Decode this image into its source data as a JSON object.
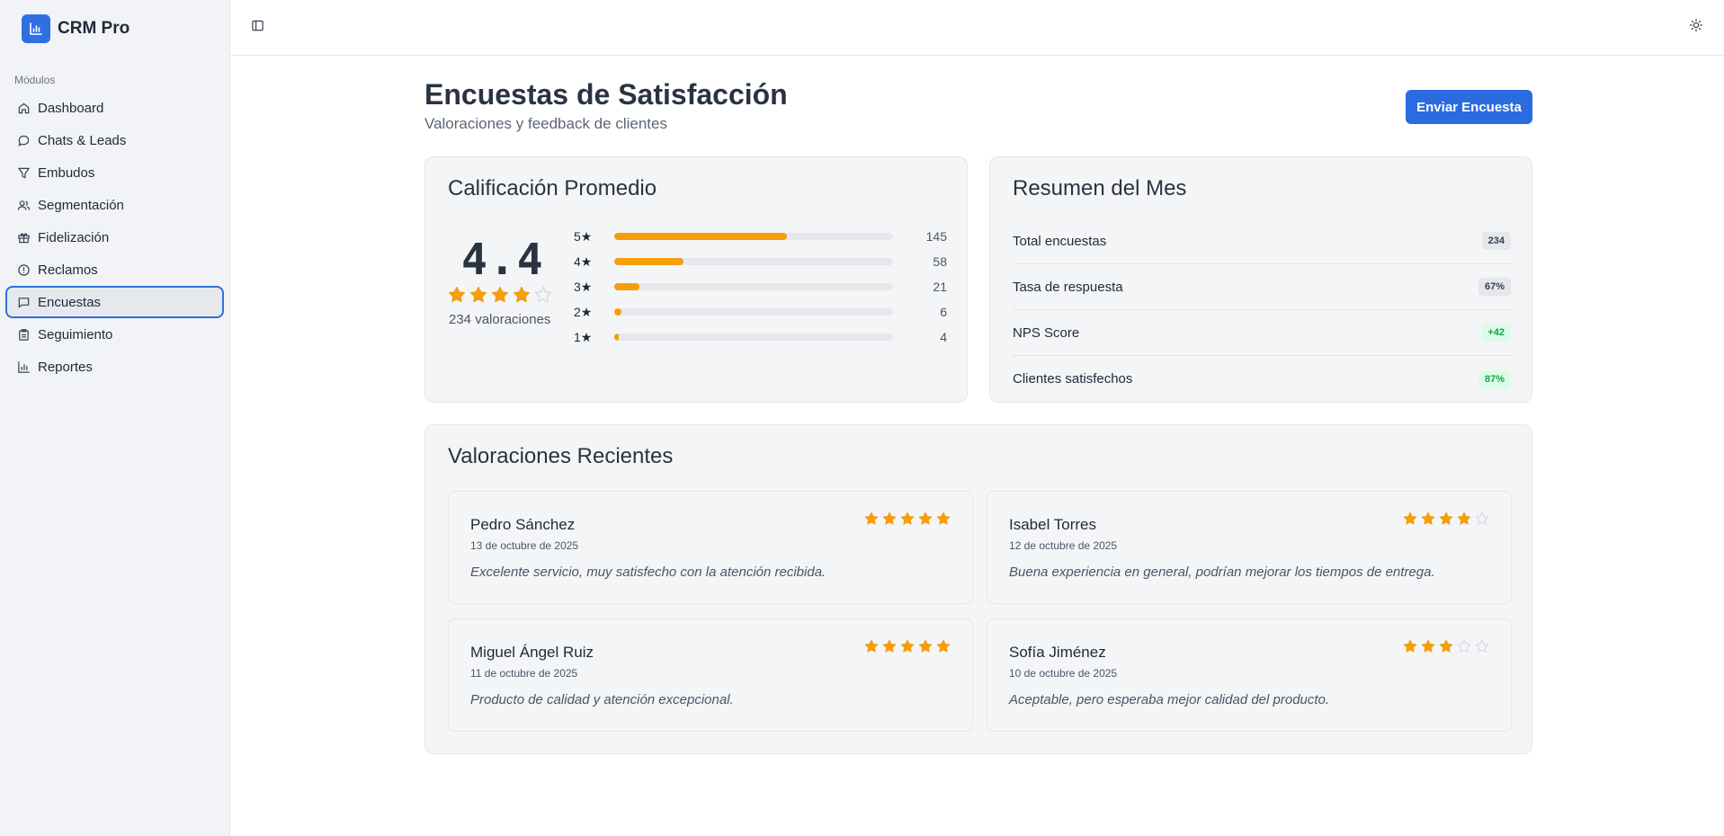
{
  "app": {
    "name": "CRM Pro",
    "logo_icon": "bar-chart-icon",
    "accent_color": "#2f6fe0"
  },
  "sidebar": {
    "section_label": "Módulos",
    "items": [
      {
        "label": "Dashboard",
        "icon": "home-icon",
        "active": false
      },
      {
        "label": "Chats & Leads",
        "icon": "chat-bubble-icon",
        "active": false
      },
      {
        "label": "Embudos",
        "icon": "funnel-icon",
        "active": false
      },
      {
        "label": "Segmentación",
        "icon": "users-icon",
        "active": false
      },
      {
        "label": "Fidelización",
        "icon": "gift-icon",
        "active": false
      },
      {
        "label": "Reclamos",
        "icon": "alert-circle-icon",
        "active": false
      },
      {
        "label": "Encuestas",
        "icon": "message-square-icon",
        "active": true
      },
      {
        "label": "Seguimiento",
        "icon": "clipboard-icon",
        "active": false
      },
      {
        "label": "Reportes",
        "icon": "bar-chart-icon",
        "active": false
      }
    ]
  },
  "topbar": {
    "toggle_icon": "sidebar-toggle-icon",
    "theme_icon": "sun-icon"
  },
  "page": {
    "title": "Encuestas de Satisfacción",
    "subtitle": "Valoraciones y feedback de clientes",
    "action_label": "Enviar Encuesta"
  },
  "rating": {
    "title": "Calificación Promedio",
    "average": "4.4",
    "stars_filled": 4,
    "stars_total": 5,
    "count_label": "234 valoraciones",
    "star_color": "#f59e0b",
    "distribution": [
      {
        "label": "5★",
        "count": 145
      },
      {
        "label": "4★",
        "count": 58
      },
      {
        "label": "3★",
        "count": 21
      },
      {
        "label": "2★",
        "count": 6
      },
      {
        "label": "1★",
        "count": 4
      }
    ]
  },
  "summary": {
    "title": "Resumen del Mes",
    "rows": [
      {
        "label": "Total encuestas",
        "value": "234",
        "tone": "neutral"
      },
      {
        "label": "Tasa de respuesta",
        "value": "67%",
        "tone": "neutral"
      },
      {
        "label": "NPS Score",
        "value": "+42",
        "tone": "green"
      },
      {
        "label": "Clientes satisfechos",
        "value": "87%",
        "tone": "green"
      }
    ]
  },
  "recent": {
    "title": "Valoraciones Recientes",
    "reviews": [
      {
        "name": "Pedro Sánchez",
        "date": "13 de octubre de 2025",
        "text": "Excelente servicio, muy satisfecho con la atención recibida.",
        "stars": 5
      },
      {
        "name": "Isabel Torres",
        "date": "12 de octubre de 2025",
        "text": "Buena experiencia en general, podrían mejorar los tiempos de entrega.",
        "stars": 4
      },
      {
        "name": "Miguel Ángel Ruiz",
        "date": "11 de octubre de 2025",
        "text": "Producto de calidad y atención excepcional.",
        "stars": 5
      },
      {
        "name": "Sofía Jiménez",
        "date": "10 de octubre de 2025",
        "text": "Aceptable, pero esperaba mejor calidad del producto.",
        "stars": 3
      }
    ]
  }
}
